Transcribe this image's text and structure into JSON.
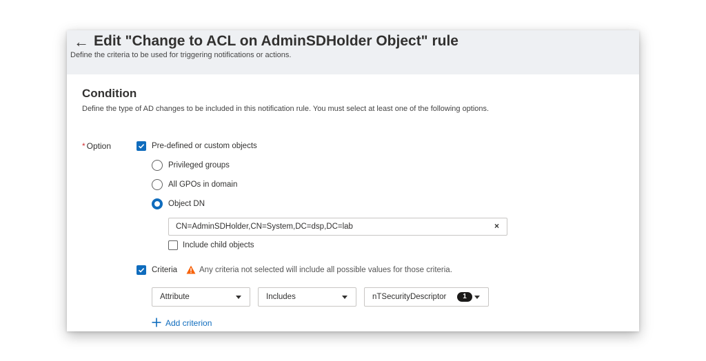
{
  "header": {
    "back_icon": "arrow-left-icon",
    "title": "Edit \"Change to ACL on AdminSDHolder Object\" rule",
    "subtitle": "Define the criteria to be used for triggering notifications or actions."
  },
  "condition": {
    "title": "Condition",
    "description": "Define the type of AD changes to be included in this notification rule. You must select at least one of the following options.",
    "option_required_mark": "*",
    "option_label": "Option",
    "predefined": {
      "label": "Pre-defined or custom objects",
      "checked": true,
      "radios": [
        {
          "label": "Privileged groups",
          "selected": false
        },
        {
          "label": "All GPOs in domain",
          "selected": false
        },
        {
          "label": "Object DN",
          "selected": true
        }
      ],
      "object_dn_value": "CN=AdminSDHolder,CN=System,DC=dsp,DC=lab",
      "clear_icon": "×",
      "include_child_label": "Include child objects",
      "include_child_checked": false
    },
    "criteria": {
      "label": "Criteria",
      "checked": true,
      "warning_icon": "warning-triangle-icon",
      "warning_text": "Any criteria not selected will include all possible values for those criteria.",
      "dropdowns": [
        {
          "value": "Attribute"
        },
        {
          "value": "Includes"
        },
        {
          "value": "nTSecurityDescriptor",
          "badge": "1"
        }
      ],
      "add_label": "Add criterion"
    }
  },
  "colors": {
    "accent": "#0f6cbd",
    "warning": "#f7630c",
    "header_bg": "#eef0f3",
    "required": "#d13438"
  }
}
